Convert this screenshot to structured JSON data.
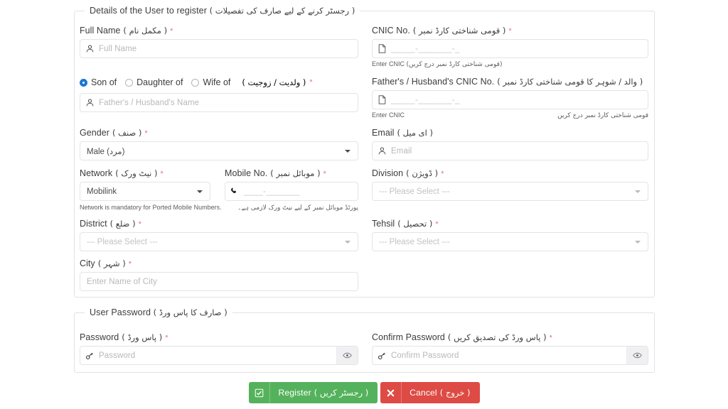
{
  "details": {
    "legend_en": "Details of the User to register",
    "legend_ur": "( رجسٹر کرنے کے لیے صارف کی تفصیلات )",
    "full_name": {
      "label_en": "Full Name",
      "label_ur": "( مکمل نام )",
      "required": "*",
      "placeholder": "Full Name",
      "icon": "user-icon"
    },
    "relation": {
      "label_ur": "( ولدیت / زوجیت )",
      "required": "*",
      "options": [
        "Son of",
        "Daughter of",
        "Wife of"
      ],
      "selected": "Son of",
      "name_placeholder": "Father's / Husband's Name",
      "icon": "user-icon"
    },
    "gender": {
      "label_en": "Gender",
      "label_ur": "( صنف )",
      "required": "*",
      "value": "Male (مرد)"
    },
    "network": {
      "label_en": "Network",
      "label_ur": "( نیٹ ورک )",
      "required": "*",
      "value": "Mobilink",
      "help_en": "Network is mandatory for Ported Mobile Numbers.",
      "help_ur": "پورٹڈ موبائل نمبر کے لیے نیٹ ورک لازمی ہے۔"
    },
    "mobile": {
      "label_en": "Mobile No.",
      "label_ur": "( موبائل نمبر )",
      "required": "*",
      "mask": "____-_______",
      "icon": "phone-icon"
    },
    "district": {
      "label_en": "District",
      "label_ur": "( ضلع )",
      "required": "*",
      "value": "--- Please Select ---"
    },
    "city": {
      "label_en": "City",
      "label_ur": "( شہر )",
      "required": "*",
      "placeholder": "Enter Name of City"
    },
    "cnic": {
      "label_en": "CNIC No.",
      "label_ur": "( قومی شناختی کارڈ نمبر )",
      "required": "*",
      "mask": "_____-_______-_",
      "icon": "document-icon",
      "help_en": "Enter CNIC",
      "help_ur": "(قومی شناختی کارڈ نمبر درج کریں)"
    },
    "father_cnic": {
      "label_en": "Father's / Husband's CNIC No.",
      "label_ur": "( والد / شوہر کا قومی شناختی کارڈ نمبر )",
      "mask": "_____-_______-_",
      "icon": "document-icon",
      "help_en": "Enter CNIC",
      "help_ur": "قومی شناختی کارڈ نمبر درج کریں"
    },
    "email": {
      "label_en": "Email",
      "label_ur": "( ای میل )",
      "placeholder": "Email",
      "icon": "user-icon"
    },
    "division": {
      "label_en": "Division",
      "label_ur": "( ڈویژن )",
      "required": "*",
      "value": "--- Please Select ---"
    },
    "tehsil": {
      "label_en": "Tehsil",
      "label_ur": "( تحصیل )",
      "required": "*",
      "value": "--- Please Select ---"
    }
  },
  "password_section": {
    "legend_en": "User Password",
    "legend_ur": "( صارف کا پاس ورڈ )",
    "password": {
      "label_en": "Password",
      "label_ur": "( پاس ورڈ )",
      "required": "*",
      "placeholder": "Password",
      "icon": "key-icon",
      "toggle_icon": "eye-icon"
    },
    "confirm_password": {
      "label_en": "Confirm Password",
      "label_ur": "( پاس ورڈ کی تصدیق کریں )",
      "required": "*",
      "placeholder": "Confirm Password",
      "icon": "key-icon",
      "toggle_icon": "eye-icon"
    }
  },
  "actions": {
    "register": {
      "label_en": "Register",
      "label_ur": "( رجسٹر کریں )",
      "icon": "checkbox-icon",
      "color": "#55b25c"
    },
    "cancel": {
      "label_en": "Cancel",
      "label_ur": "( خروج )",
      "icon": "close-icon",
      "color": "#dd4b44"
    }
  }
}
